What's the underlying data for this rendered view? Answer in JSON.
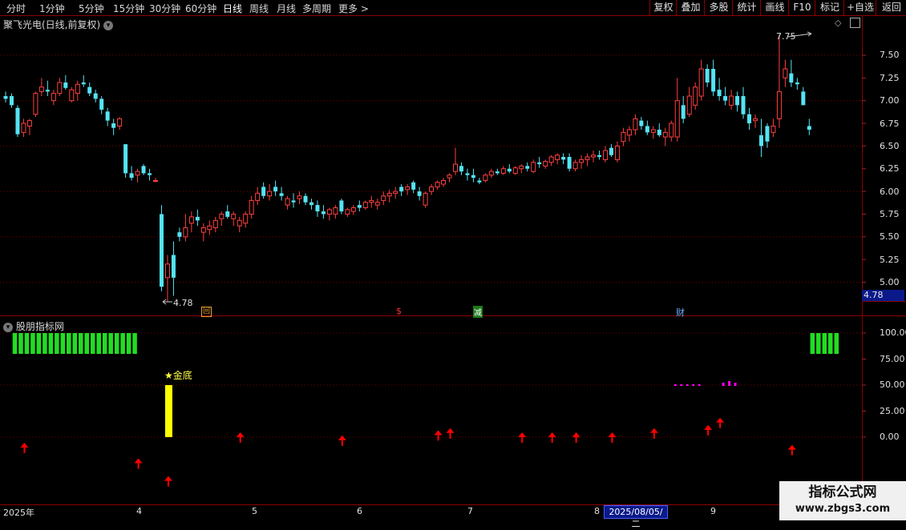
{
  "toolbar": {
    "periods": [
      "分时",
      "1分钟",
      "5分钟",
      "15分钟",
      "30分钟",
      "60分钟",
      "日线",
      "周线",
      "月线",
      "多周期",
      "更多 >"
    ],
    "active_period": "日线",
    "right_buttons": [
      "复权",
      "叠加",
      "多股",
      "统计",
      "画线",
      "F10",
      "标记",
      "+自选",
      "返回"
    ]
  },
  "chart_header": {
    "stock_name": "聚飞光电(日线,前复权)",
    "chevron_icon": "chevron-down-icon",
    "diamond_icon": "diamond-icon",
    "layout_icon": "window-icon"
  },
  "price_axis": {
    "ticks": [
      "7.50",
      "7.25",
      "7.00",
      "6.75",
      "6.50",
      "6.25",
      "6.00",
      "5.75",
      "5.50",
      "5.25",
      "5.00"
    ],
    "current_price": "4.78"
  },
  "annotations": {
    "high": "7.75",
    "low": "4.78",
    "markers": [
      "回",
      "$",
      "减",
      "财"
    ]
  },
  "indicator": {
    "name": "股朋指标网",
    "ticks": [
      "100.00",
      "75.00",
      "50.00",
      "25.00",
      "0.00"
    ],
    "signal_label": "★金底"
  },
  "date_axis": {
    "labels": [
      "2025年",
      "4",
      "5",
      "6",
      "7",
      "8",
      "9"
    ],
    "selected": "2025/08/05/二"
  },
  "watermark": {
    "line1": "指标公式网",
    "line2": "www.zbgs3.com"
  },
  "colors": {
    "up": "#ff4040",
    "down": "#54e4f4",
    "grid": "#7a0000",
    "signal_bar": "#ffff00",
    "green_bar": "#22dd22",
    "arrow": "#ff0000",
    "magenta": "#ff00ff"
  },
  "chart_data": {
    "type": "candlestick",
    "y_range": [
      4.7,
      7.95
    ],
    "indicator_range": [
      -30,
      115
    ],
    "candles": [
      [
        7.05,
        7.1,
        6.98,
        7.02
      ],
      [
        7.05,
        7.08,
        6.92,
        6.95
      ],
      [
        6.92,
        6.95,
        6.6,
        6.63
      ],
      [
        6.65,
        6.8,
        6.6,
        6.75
      ],
      [
        6.72,
        6.8,
        6.62,
        6.78
      ],
      [
        6.85,
        7.1,
        6.82,
        7.08
      ],
      [
        7.1,
        7.25,
        7.05,
        7.15
      ],
      [
        7.12,
        7.22,
        7.05,
        7.1
      ],
      [
        7.0,
        7.12,
        6.95,
        7.08
      ],
      [
        7.08,
        7.25,
        7.05,
        7.2
      ],
      [
        7.2,
        7.28,
        7.12,
        7.14
      ],
      [
        7.0,
        7.15,
        6.98,
        7.12
      ],
      [
        7.08,
        7.22,
        7.0,
        7.18
      ],
      [
        7.2,
        7.28,
        7.15,
        7.18
      ],
      [
        7.15,
        7.2,
        7.05,
        7.08
      ],
      [
        7.08,
        7.12,
        6.98,
        7.02
      ],
      [
        7.02,
        7.05,
        6.85,
        6.9
      ],
      [
        6.88,
        6.92,
        6.72,
        6.78
      ],
      [
        6.75,
        6.8,
        6.62,
        6.7
      ],
      [
        6.72,
        6.82,
        6.68,
        6.8
      ],
      [
        6.52,
        6.52,
        6.15,
        6.2
      ],
      [
        6.2,
        6.28,
        6.12,
        6.15
      ],
      [
        6.18,
        6.25,
        6.1,
        6.22
      ],
      [
        6.28,
        6.3,
        6.18,
        6.2
      ],
      [
        6.2,
        6.25,
        6.12,
        6.18
      ],
      [
        6.12,
        6.15,
        6.1,
        6.12
      ],
      [
        5.75,
        5.85,
        4.9,
        4.95
      ],
      [
        5.05,
        5.3,
        4.78,
        5.2
      ],
      [
        5.3,
        5.45,
        4.85,
        5.05
      ],
      [
        5.55,
        5.6,
        5.45,
        5.5
      ],
      [
        5.5,
        5.75,
        5.45,
        5.6
      ],
      [
        5.65,
        5.78,
        5.55,
        5.72
      ],
      [
        5.72,
        5.8,
        5.62,
        5.68
      ],
      [
        5.55,
        5.65,
        5.45,
        5.6
      ],
      [
        5.58,
        5.68,
        5.52,
        5.62
      ],
      [
        5.6,
        5.72,
        5.55,
        5.68
      ],
      [
        5.7,
        5.78,
        5.62,
        5.75
      ],
      [
        5.78,
        5.85,
        5.7,
        5.72
      ],
      [
        5.7,
        5.78,
        5.62,
        5.75
      ],
      [
        5.62,
        5.72,
        5.55,
        5.68
      ],
      [
        5.65,
        5.78,
        5.6,
        5.75
      ],
      [
        5.75,
        5.95,
        5.7,
        5.9
      ],
      [
        5.9,
        6.05,
        5.85,
        5.98
      ],
      [
        6.05,
        6.1,
        5.92,
        5.95
      ],
      [
        5.95,
        6.08,
        5.9,
        6.0
      ],
      [
        6.05,
        6.12,
        5.95,
        6.0
      ],
      [
        5.98,
        6.05,
        5.9,
        5.95
      ],
      [
        5.85,
        5.95,
        5.8,
        5.92
      ],
      [
        5.9,
        5.98,
        5.82,
        5.88
      ],
      [
        5.92,
        6.0,
        5.86,
        5.95
      ],
      [
        5.95,
        5.98,
        5.85,
        5.88
      ],
      [
        5.88,
        5.92,
        5.8,
        5.85
      ],
      [
        5.85,
        5.9,
        5.72,
        5.78
      ],
      [
        5.78,
        5.85,
        5.7,
        5.75
      ],
      [
        5.75,
        5.82,
        5.68,
        5.8
      ],
      [
        5.75,
        5.85,
        5.7,
        5.82
      ],
      [
        5.9,
        5.92,
        5.75,
        5.78
      ],
      [
        5.75,
        5.82,
        5.72,
        5.8
      ],
      [
        5.78,
        5.85,
        5.74,
        5.82
      ],
      [
        5.85,
        5.9,
        5.78,
        5.82
      ],
      [
        5.82,
        5.9,
        5.8,
        5.88
      ],
      [
        5.88,
        5.95,
        5.82,
        5.9
      ],
      [
        5.85,
        5.92,
        5.8,
        5.88
      ],
      [
        5.9,
        6.0,
        5.85,
        5.95
      ],
      [
        5.95,
        6.02,
        5.88,
        5.98
      ],
      [
        5.98,
        6.05,
        5.92,
        6.0
      ],
      [
        6.05,
        6.08,
        5.95,
        6.0
      ],
      [
        6.02,
        6.08,
        5.96,
        6.05
      ],
      [
        6.1,
        6.12,
        5.98,
        6.02
      ],
      [
        6.0,
        6.05,
        5.9,
        5.95
      ],
      [
        5.85,
        6.0,
        5.82,
        5.98
      ],
      [
        6.0,
        6.08,
        5.96,
        6.05
      ],
      [
        6.05,
        6.12,
        6.02,
        6.1
      ],
      [
        6.08,
        6.15,
        6.05,
        6.12
      ],
      [
        6.15,
        6.2,
        6.1,
        6.18
      ],
      [
        6.22,
        6.48,
        6.18,
        6.3
      ],
      [
        6.28,
        6.32,
        6.18,
        6.22
      ],
      [
        6.2,
        6.25,
        6.12,
        6.18
      ],
      [
        6.18,
        6.25,
        6.1,
        6.15
      ],
      [
        6.12,
        6.15,
        6.08,
        6.1
      ],
      [
        6.12,
        6.2,
        6.1,
        6.18
      ],
      [
        6.18,
        6.25,
        6.15,
        6.22
      ],
      [
        6.22,
        6.25,
        6.18,
        6.2
      ],
      [
        6.2,
        6.28,
        6.18,
        6.25
      ],
      [
        6.25,
        6.3,
        6.2,
        6.22
      ],
      [
        6.2,
        6.28,
        6.18,
        6.26
      ],
      [
        6.25,
        6.3,
        6.2,
        6.28
      ],
      [
        6.28,
        6.32,
        6.22,
        6.25
      ],
      [
        6.22,
        6.35,
        6.2,
        6.32
      ],
      [
        6.32,
        6.38,
        6.26,
        6.3
      ],
      [
        6.28,
        6.35,
        6.25,
        6.33
      ],
      [
        6.32,
        6.4,
        6.28,
        6.38
      ],
      [
        6.35,
        6.42,
        6.3,
        6.4
      ],
      [
        6.38,
        6.42,
        6.3,
        6.35
      ],
      [
        6.38,
        6.42,
        6.22,
        6.25
      ],
      [
        6.25,
        6.35,
        6.22,
        6.32
      ],
      [
        6.32,
        6.4,
        6.25,
        6.35
      ],
      [
        6.35,
        6.42,
        6.28,
        6.38
      ],
      [
        6.38,
        6.45,
        6.32,
        6.4
      ],
      [
        6.4,
        6.45,
        6.35,
        6.38
      ],
      [
        6.35,
        6.5,
        6.32,
        6.45
      ],
      [
        6.48,
        6.52,
        6.38,
        6.4
      ],
      [
        6.35,
        6.55,
        6.32,
        6.5
      ],
      [
        6.55,
        6.7,
        6.5,
        6.65
      ],
      [
        6.62,
        6.72,
        6.55,
        6.68
      ],
      [
        6.68,
        6.85,
        6.62,
        6.8
      ],
      [
        6.78,
        6.82,
        6.68,
        6.72
      ],
      [
        6.72,
        6.78,
        6.62,
        6.65
      ],
      [
        6.65,
        6.72,
        6.58,
        6.68
      ],
      [
        6.68,
        6.75,
        6.6,
        6.62
      ],
      [
        6.6,
        6.7,
        6.5,
        6.65
      ],
      [
        6.6,
        6.78,
        6.55,
        6.75
      ],
      [
        6.6,
        7.25,
        6.55,
        7.0
      ],
      [
        6.95,
        7.05,
        6.75,
        6.8
      ],
      [
        6.85,
        7.15,
        6.82,
        7.05
      ],
      [
        6.95,
        7.2,
        6.9,
        7.15
      ],
      [
        7.05,
        7.45,
        7.0,
        7.35
      ],
      [
        7.35,
        7.4,
        7.15,
        7.2
      ],
      [
        7.35,
        7.45,
        7.05,
        7.1
      ],
      [
        7.12,
        7.25,
        7.0,
        7.05
      ],
      [
        7.05,
        7.15,
        6.95,
        7.0
      ],
      [
        6.95,
        7.12,
        6.9,
        7.05
      ],
      [
        7.05,
        7.1,
        6.88,
        6.95
      ],
      [
        7.05,
        7.15,
        6.8,
        6.85
      ],
      [
        6.85,
        6.92,
        6.68,
        6.75
      ],
      [
        6.78,
        6.85,
        6.7,
        6.8
      ],
      [
        6.62,
        6.8,
        6.38,
        6.5
      ],
      [
        6.72,
        6.75,
        6.48,
        6.55
      ],
      [
        6.65,
        6.8,
        6.6,
        6.72
      ],
      [
        6.8,
        7.72,
        6.7,
        7.1
      ],
      [
        7.25,
        7.45,
        7.15,
        7.35
      ],
      [
        7.3,
        7.45,
        7.15,
        7.2
      ],
      [
        7.2,
        7.25,
        7.12,
        7.18
      ],
      [
        7.1,
        7.15,
        6.95,
        6.95
      ],
      [
        6.72,
        6.8,
        6.62,
        6.68
      ]
    ],
    "signal": {
      "index": 27,
      "value": 50,
      "label": "★金底"
    },
    "green_bars": {
      "ranges": [
        [
          0,
          20
        ],
        [
          133,
          137
        ]
      ],
      "value": 100
    },
    "magenta_dashes": [
      [
        111,
        115,
        50
      ],
      [
        119,
        121,
        50
      ]
    ],
    "arrows": [
      [
        3,
        -10
      ],
      [
        22,
        -25
      ],
      [
        27,
        -42
      ],
      [
        39,
        0
      ],
      [
        56,
        -3
      ],
      [
        72,
        2
      ],
      [
        74,
        4
      ],
      [
        86,
        0
      ],
      [
        91,
        0
      ],
      [
        95,
        0
      ],
      [
        101,
        0
      ],
      [
        108,
        4
      ],
      [
        117,
        7
      ],
      [
        119,
        14
      ],
      [
        131,
        -12
      ]
    ]
  }
}
